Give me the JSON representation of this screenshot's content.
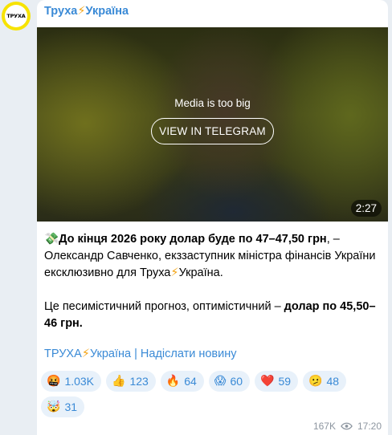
{
  "avatar": {
    "text": "ТРУХА"
  },
  "channel": {
    "name_part1": "Труха",
    "bolt": "⚡",
    "name_part2": "Україна"
  },
  "media": {
    "notice": "Media is too big",
    "button_label": "VIEW IN TELEGRAM",
    "duration": "2:27"
  },
  "post": {
    "emoji": "💸",
    "bold1": "До кінця 2026 року долар буде по 47–47,50 грн",
    "text1": ", – Олександр Савченко, екззаступник міністра фінансів України ексклюзивно для Труха",
    "bolt": "⚡",
    "text2": "Україна.",
    "text3": "Це песимістичний прогноз, оптимістичний – ",
    "bold2": "долар по 45,50–46 грн."
  },
  "footer_link": {
    "part1": "ТРУХА",
    "bolt": "⚡",
    "part2": "Україна | Надіслати новину"
  },
  "reactions": [
    {
      "icon": "🤬",
      "icon_name": "angry-face-icon",
      "count": "1.03K"
    },
    {
      "icon": "👍",
      "icon_name": "thumbs-up-icon",
      "count": "123"
    },
    {
      "icon": "🔥",
      "icon_name": "fire-icon",
      "count": "64"
    },
    {
      "icon": "😱",
      "icon_name": "screaming-face-icon",
      "count": "60"
    },
    {
      "icon": "❤️",
      "icon_name": "heart-icon",
      "count": "59"
    },
    {
      "icon": "🫤",
      "icon_name": "diagonal-mouth-icon",
      "count": "48"
    },
    {
      "icon": "🤯",
      "icon_name": "exploding-head-icon",
      "count": "31"
    }
  ],
  "meta": {
    "views": "167K",
    "time": "17:20"
  },
  "colors": {
    "link": "#3a8ad6",
    "reaction_bg": "#e8f1fa",
    "avatar_ring": "#f7e300"
  }
}
